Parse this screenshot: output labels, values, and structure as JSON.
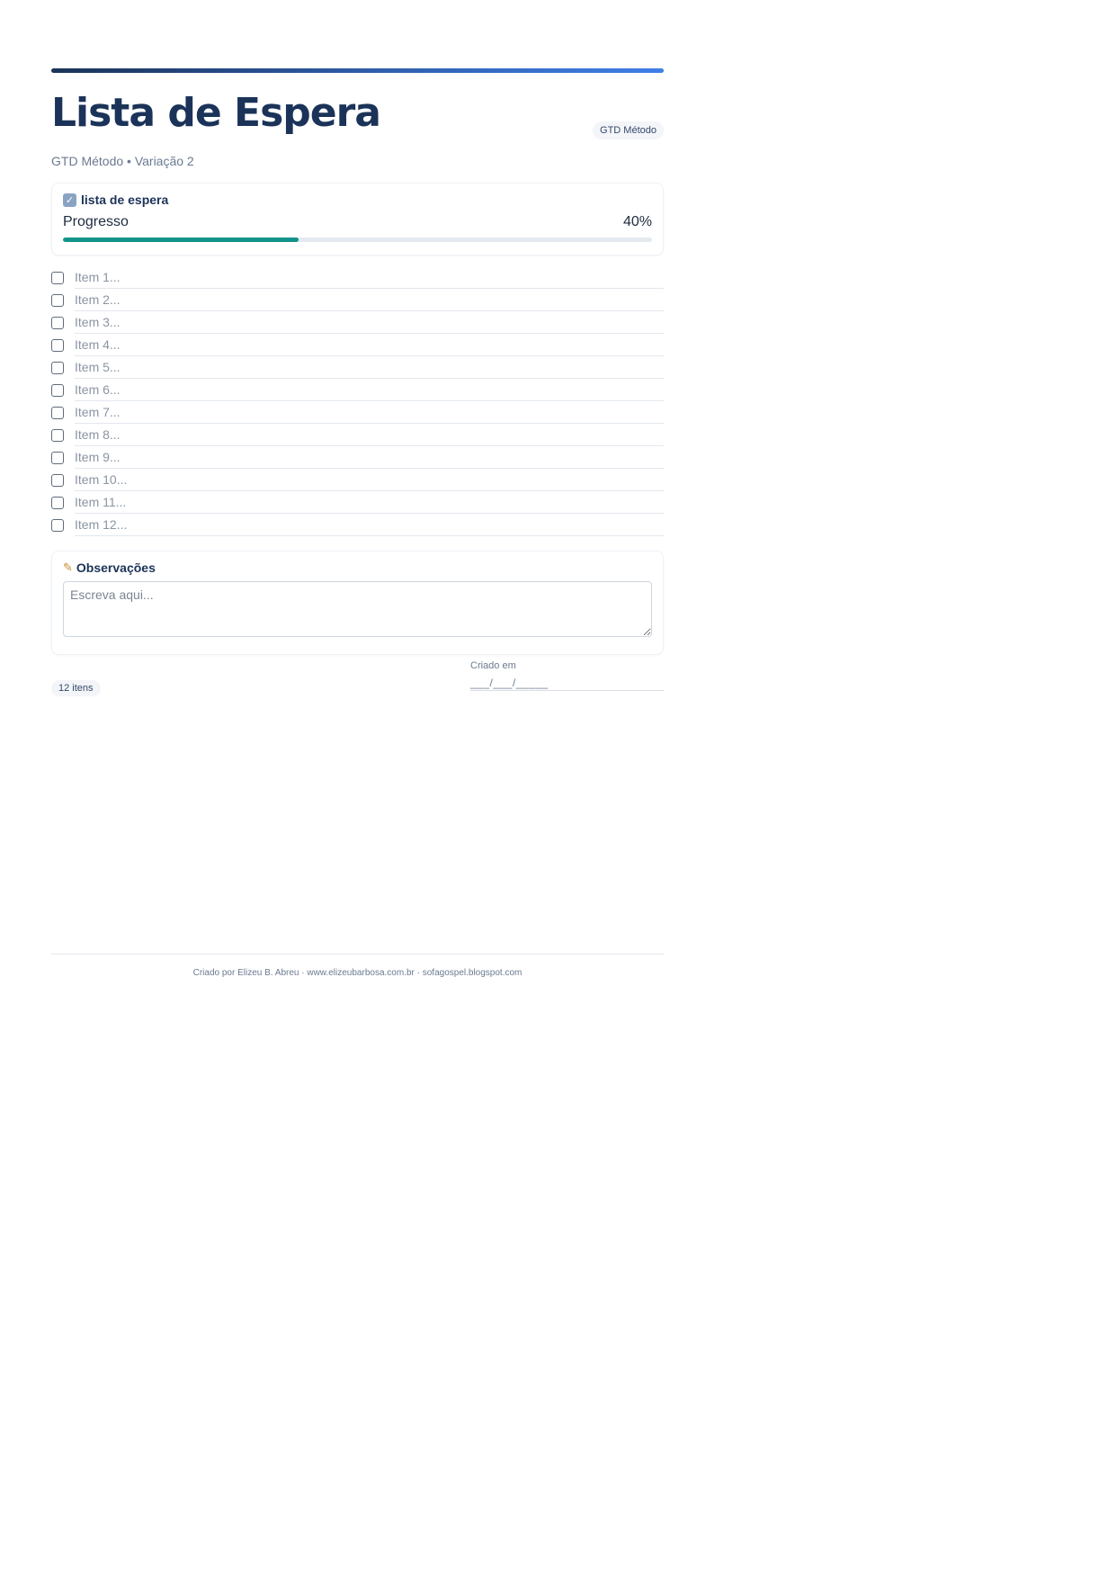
{
  "header": {
    "title": "Lista de Espera",
    "subtitle": "GTD Método • Variação 2",
    "badge": "GTD Método"
  },
  "progress_card": {
    "icon": "checkbox-emoji-icon",
    "title": "lista de espera",
    "label": "Progresso",
    "percent_text": "40%",
    "percent_value": 40,
    "fill_color": "#13948a"
  },
  "items": [
    "Item 1...",
    "Item 2...",
    "Item 3...",
    "Item 4...",
    "Item 5...",
    "Item 6...",
    "Item 7...",
    "Item 8...",
    "Item 9...",
    "Item 10...",
    "Item 11...",
    "Item 12..."
  ],
  "notes": {
    "icon": "memo-emoji-icon",
    "title": "Observações",
    "placeholder": "Escreva aqui..."
  },
  "meta": {
    "count_badge": "12 itens",
    "created_label": "Criado em",
    "created_value": "___/___/_____"
  },
  "footer": {
    "credits": "Criado por Elizeu B. Abreu · www.elizeubarbosa.com.br · sofagospel.blogspot.com"
  },
  "colors": {
    "title": "#1b3358",
    "accent_gradient_start": "#1b3358",
    "accent_gradient_end": "#3f7fe6"
  }
}
